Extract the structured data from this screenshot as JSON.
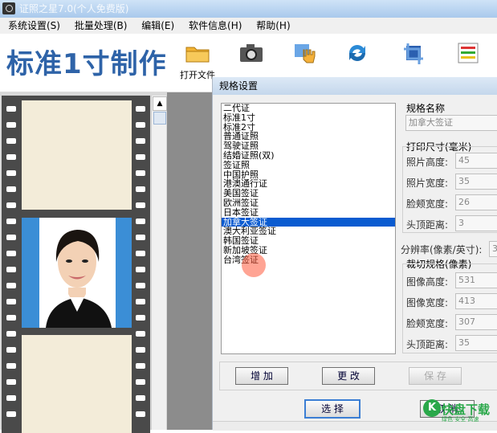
{
  "window": {
    "title": "证照之星7.0(个人免费版)"
  },
  "menu": [
    "系统设置(S)",
    "批量处理(B)",
    "编辑(E)",
    "软件信息(H)",
    "帮助(H)"
  ],
  "brand": "标准1寸制作",
  "toolbar": [
    {
      "label": "打开文件",
      "icon": "folder-icon"
    },
    {
      "label": "",
      "icon": "camera-icon"
    },
    {
      "label": "",
      "icon": "hand-icon"
    },
    {
      "label": "",
      "icon": "rotate-icon"
    },
    {
      "label": "",
      "icon": "crop-icon"
    },
    {
      "label": "",
      "icon": "color-icon"
    }
  ],
  "dialog": {
    "title": "规格设置",
    "list": [
      "二代证",
      "标准1寸",
      "标准2寸",
      "普通证照",
      "驾驶证照",
      "结婚证照(双)",
      "签证照",
      "中国护照",
      "港澳通行证",
      "美国签证",
      "欧洲签证",
      "日本签证",
      "加拿大签证",
      "澳大利亚签证",
      "韩国签证",
      "新加坡签证",
      "台湾签证"
    ],
    "selected_index": 12,
    "spec_name_label": "规格名称",
    "spec_name_value": "加拿大签证",
    "print_size_label": "打印尺寸(毫米)",
    "print_fields": [
      {
        "label": "照片高度:",
        "value": "45"
      },
      {
        "label": "照片宽度:",
        "value": "35"
      },
      {
        "label": "脸颊宽度:",
        "value": "26"
      },
      {
        "label": "头顶距离:",
        "value": "3"
      }
    ],
    "resolution_label": "分辨率(像素/英寸):",
    "resolution_value": "3",
    "crop_label": "裁切规格(像素)",
    "crop_fields": [
      {
        "label": "图像高度:",
        "value": "531"
      },
      {
        "label": "图像宽度:",
        "value": "413"
      },
      {
        "label": "脸颊宽度:",
        "value": "307"
      },
      {
        "label": "头顶距离:",
        "value": "35"
      }
    ],
    "buttons": {
      "add": "增 加",
      "edit": "更 改",
      "save": "保 存",
      "select": "选 择",
      "cancel": "取 消"
    }
  },
  "watermark": {
    "logo": "K",
    "text": "快盘下载",
    "sub": "绿色·安全·高速"
  }
}
